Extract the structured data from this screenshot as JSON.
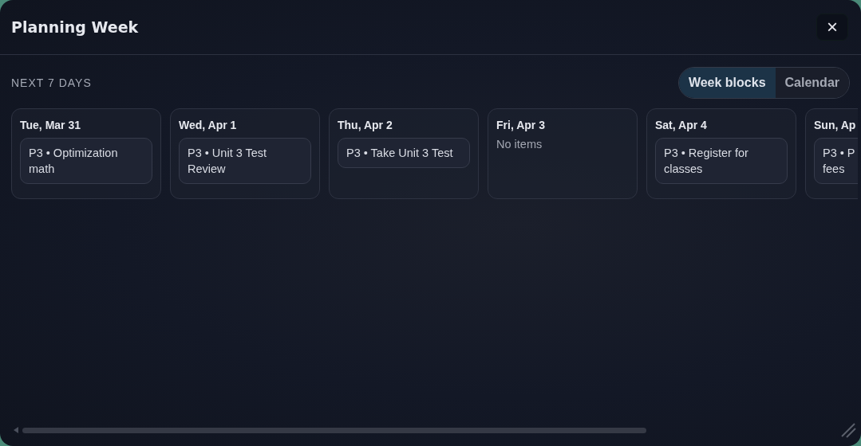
{
  "dialog": {
    "title": "Planning Week",
    "close": "×"
  },
  "section_label": "NEXT 7 DAYS",
  "view_toggle": [
    {
      "label": "Week blocks",
      "selected": true
    },
    {
      "label": "Calendar",
      "selected": false
    }
  ],
  "days": [
    {
      "date": "Tue, Mar 31",
      "items": [
        "P3 • Optimization math"
      ]
    },
    {
      "date": "Wed, Apr 1",
      "items": [
        "P3 • Unit 3 Test Review"
      ]
    },
    {
      "date": "Thu, Apr 2",
      "items": [
        "P3 • Take Unit 3 Test"
      ]
    },
    {
      "date": "Fri, Apr 3",
      "empty_text": "No items"
    },
    {
      "date": "Sat, Apr 4",
      "items": [
        "P3 • Register for classes"
      ]
    },
    {
      "date": "Sun, Ap",
      "items": [
        "P3 • P\nfees"
      ]
    }
  ]
}
